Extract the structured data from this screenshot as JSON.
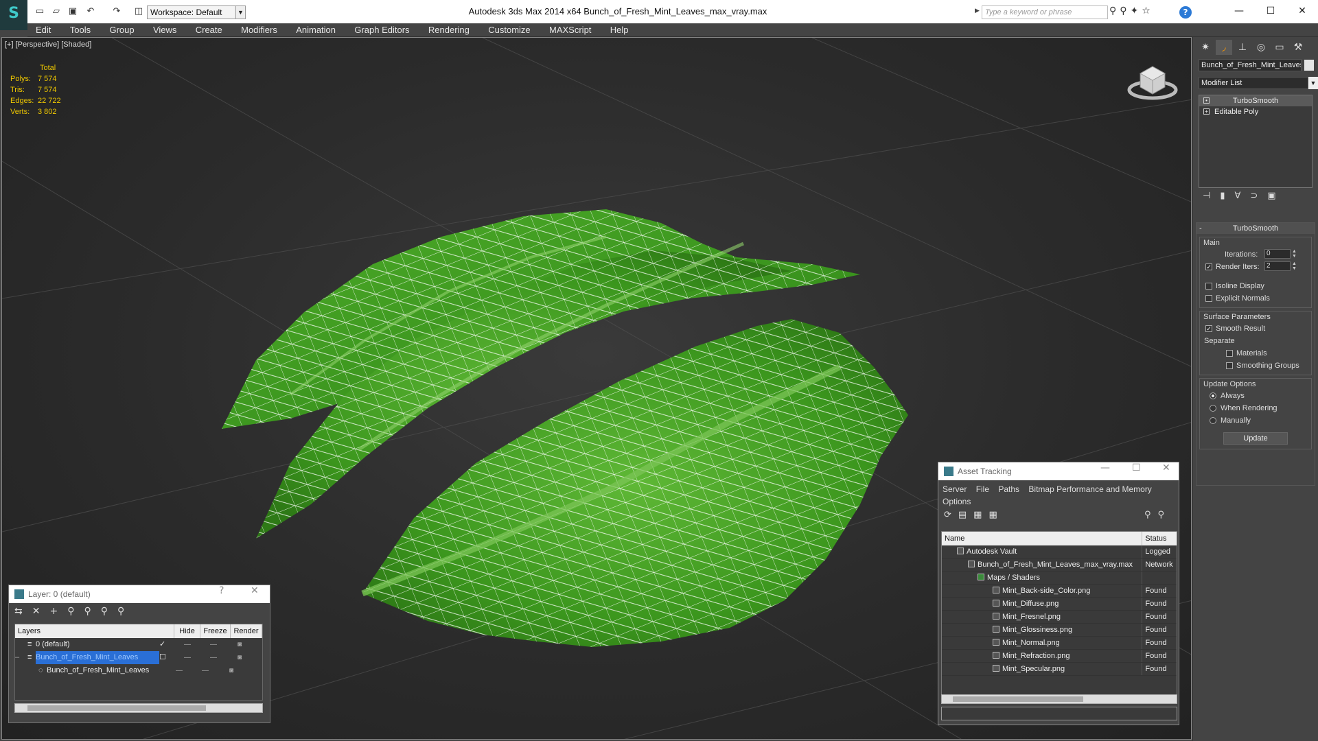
{
  "app": {
    "title": "Autodesk 3ds Max  2014 x64     Bunch_of_Fresh_Mint_Leaves_max_vray.max",
    "workspace": "Workspace: Default",
    "search_placeholder": "Type a keyword or phrase"
  },
  "menu": [
    "Edit",
    "Tools",
    "Group",
    "Views",
    "Create",
    "Modifiers",
    "Animation",
    "Graph Editors",
    "Rendering",
    "Customize",
    "MAXScript",
    "Help"
  ],
  "viewport": {
    "label": "[+] [Perspective] [Shaded]",
    "stats": {
      "header": "Total",
      "rows": [
        {
          "k": "Polys:",
          "v": "7 574"
        },
        {
          "k": "Tris:",
          "v": "7 574"
        },
        {
          "k": "Edges:",
          "v": "22 722"
        },
        {
          "k": "Verts:",
          "v": "3 802"
        }
      ]
    }
  },
  "command_panel": {
    "object_name": "Bunch_of_Fresh_Mint_Leaves",
    "modifier_list": "Modifier List",
    "stack": [
      "TurboSmooth",
      "Editable Poly"
    ],
    "rollout_title": "TurboSmooth",
    "main_group": "Main",
    "iterations_label": "Iterations:",
    "iterations_value": "0",
    "render_iters_label": "Render Iters:",
    "render_iters_value": "2",
    "isoline_label": "Isoline Display",
    "explicit_normals_label": "Explicit Normals",
    "surface_group": "Surface Parameters",
    "smooth_result_label": "Smooth Result",
    "separate_label": "Separate",
    "materials_label": "Materials",
    "smoothing_groups_label": "Smoothing Groups",
    "update_group": "Update Options",
    "update_options": [
      "Always",
      "When Rendering",
      "Manually"
    ],
    "update_button": "Update"
  },
  "layer_window": {
    "title": "Layer: 0 (default)",
    "columns": [
      "Layers",
      "Hide",
      "Freeze",
      "Render"
    ],
    "rows": [
      "0 (default)",
      "Bunch_of_Fresh_Mint_Leaves",
      "Bunch_of_Fresh_Mint_Leaves"
    ]
  },
  "asset_window": {
    "title": "Asset Tracking",
    "menu": [
      "Server",
      "File",
      "Paths",
      "Bitmap Performance and Memory",
      "Options"
    ],
    "columns": [
      "Name",
      "Status"
    ],
    "rows": [
      {
        "name": "Autodesk Vault",
        "status": "Logged"
      },
      {
        "name": "Bunch_of_Fresh_Mint_Leaves_max_vray.max",
        "status": "Network"
      },
      {
        "name": "Maps / Shaders",
        "status": ""
      },
      {
        "name": "Mint_Back-side_Color.png",
        "status": "Found"
      },
      {
        "name": "Mint_Diffuse.png",
        "status": "Found"
      },
      {
        "name": "Mint_Fresnel.png",
        "status": "Found"
      },
      {
        "name": "Mint_Glossiness.png",
        "status": "Found"
      },
      {
        "name": "Mint_Normal.png",
        "status": "Found"
      },
      {
        "name": "Mint_Refraction.png",
        "status": "Found"
      },
      {
        "name": "Mint_Specular.png",
        "status": "Found"
      }
    ]
  }
}
